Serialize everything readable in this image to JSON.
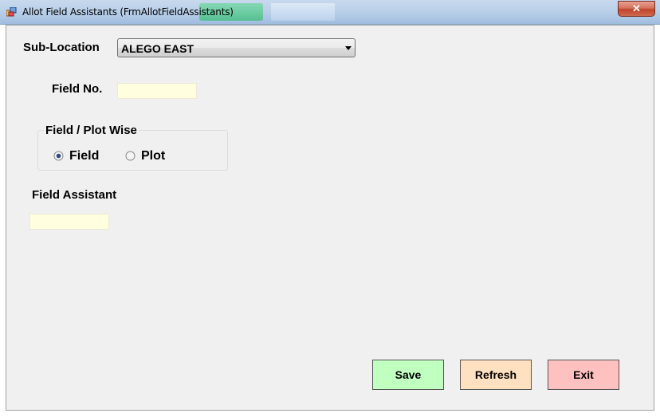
{
  "window": {
    "title": "Allot Field Assistants (FrmAllotFieldAssistants)",
    "close_label": "✕"
  },
  "form": {
    "sub_location_label": "Sub-Location",
    "sub_location_value": "ALEGO EAST",
    "field_no_label": "Field No.",
    "field_no_value": "",
    "group_caption": "Field / Plot Wise",
    "radio_field_label": "Field",
    "radio_plot_label": "Plot",
    "selected_option": "Field",
    "field_assistant_label": "Field Assistant",
    "field_assistant_value": ""
  },
  "buttons": {
    "save_label": "Save",
    "refresh_label": "Refresh",
    "exit_label": "Exit"
  },
  "colors": {
    "save_bg": "#c0ffc0",
    "refresh_bg": "#ffe0c0",
    "exit_bg": "#ffc0c0",
    "textbox_bg": "#ffffe0"
  }
}
